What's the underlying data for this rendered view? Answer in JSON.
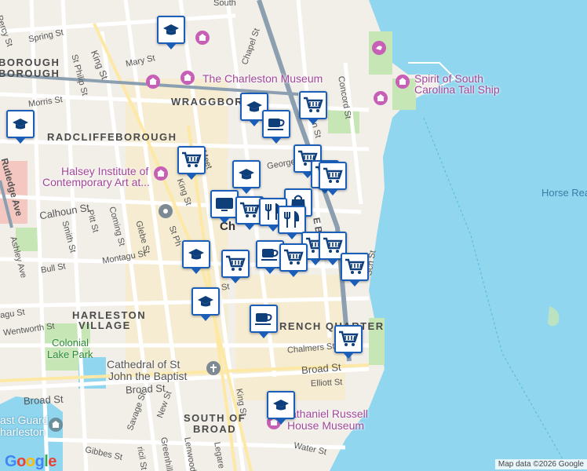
{
  "map": {
    "attribution": "Map data ©2026 Google",
    "logo": "Google",
    "colors": {
      "water": "#8fd6ee",
      "land": "#f2efe9",
      "road": "#ffffff",
      "highway": "#8c9fb0",
      "arterial": "#fde9a5",
      "park": "#c7e6b5",
      "urban": "#f6ebc8",
      "marker_border": "#1a5eb8",
      "marker_icon": "#0f3f7a",
      "museum_pin": "#c85fb7"
    },
    "labels": {
      "south": "South",
      "percy_st": "Percy St",
      "spring_st": "Spring St",
      "borough1": "BOROUGH",
      "borough2": "BOROUGH",
      "mary_st": "Mary St",
      "king_st_n": "King St",
      "st_philip_st": "St Philip St",
      "chapel_st": "Chapel St",
      "charleston_museum": "The Charleston Museum",
      "spirit_line1": "Spirit of South",
      "spirit_line2": "Carolina Tall Ship",
      "concord_st": "Concord St",
      "wraggborough": "WRAGGBORO",
      "morris_st": "Morris St",
      "radcliffeborough": "RADCLIFFEBOROUGH",
      "rutledge_ave": "Rutledge Ave",
      "ington_st": "ington St",
      "george_st": "George St",
      "meeting_st": "Meet",
      "halsey_line1": "Halsey Institute of",
      "halsey_line2": "Contemporary Art at...",
      "king_st_mid": "King St",
      "horse_reach": "Horse Rea",
      "calhoun_st": "Calhoun St",
      "pitt_st": "Pitt St",
      "coming_st": "Coming St",
      "smith_st": "Smith St",
      "ashley_ave": "Ashley Ave",
      "glebe_st": "Glebe St",
      "st_ph": "St Ph",
      "city_partial": "Ch",
      "e_bay": "E B",
      "montagu_st": "Montagu St",
      "bull_st": "Bull St",
      "wentworth_st": "Wentworth St",
      "agu_st": "agu St",
      "harleston1": "HARLESTON",
      "harleston2": "VILLAGE",
      "st_fragment": "St",
      "french_quarter": "RENCH QUARTER",
      "colonial1": "Colonial",
      "colonial2": "Lake Park",
      "chalmers_st": "Chalmers St",
      "cathedral1": "Cathedral of St",
      "cathedral2": "John the Baptist",
      "broad_st_e": "Broad St",
      "elliott_st": "Elliott St",
      "broad_st_w": "Broad St",
      "broad_st_sw": "Broad St",
      "king_st_s": "King St",
      "south_of1": "SOUTH OF",
      "south_of2": "BROAD",
      "nathaniel1": "athaniel Russell",
      "nathaniel2": "House Museum",
      "coast_guard1": "ast Guard",
      "coast_guard2": "harleston",
      "savage_st": "Savage St",
      "new_st": "New St",
      "greenhill_st": "Greenhill St",
      "lenwood": "Lenwood",
      "legare": "Legare",
      "gibbes_st": "Gibbes St",
      "ricil": "ricil St",
      "water_st": "Water St",
      "sch_st": "Sch St"
    },
    "markers": [
      {
        "type": "school-icon"
      },
      {
        "type": "school-icon"
      },
      {
        "type": "shopping-cart-icon"
      },
      {
        "type": "school-icon"
      },
      {
        "type": "coffee-cup-icon"
      },
      {
        "type": "shopping-cart-icon"
      },
      {
        "type": "shopping-cart-icon"
      },
      {
        "type": "shopping-cart-icon"
      },
      {
        "type": "shopping-cart-icon"
      },
      {
        "type": "school-icon"
      },
      {
        "type": "shopping-bag-icon"
      },
      {
        "type": "tv-icon"
      },
      {
        "type": "shopping-cart-icon"
      },
      {
        "type": "restaurant-icon"
      },
      {
        "type": "restaurant-icon"
      },
      {
        "type": "shopping-cart-icon"
      },
      {
        "type": "school-icon"
      },
      {
        "type": "shopping-cart-icon"
      },
      {
        "type": "coffee-cup-icon"
      },
      {
        "type": "shopping-cart-icon"
      },
      {
        "type": "shopping-cart-icon"
      },
      {
        "type": "shopping-cart-icon"
      },
      {
        "type": "school-icon"
      },
      {
        "type": "coffee-cup-icon"
      },
      {
        "type": "shopping-cart-icon"
      },
      {
        "type": "school-icon"
      }
    ]
  }
}
